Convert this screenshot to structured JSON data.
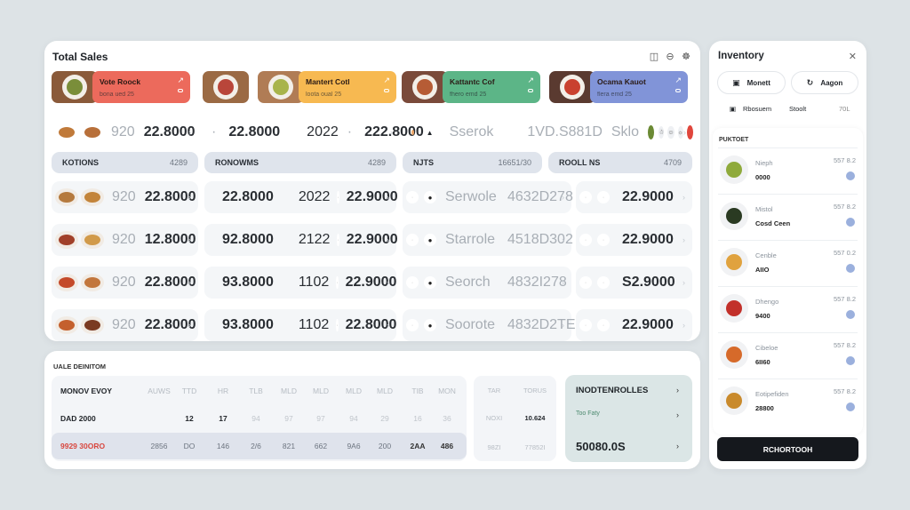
{
  "sales": {
    "title": "Total Sales",
    "header_icons": [
      "calendar-icon",
      "filter-icon",
      "globe-icon"
    ],
    "categories": [
      {
        "name": "Vote Roock",
        "sub": "bona ued 25",
        "color": "#ec6a5c",
        "food_color": "#7a8e3a"
      },
      {
        "name": "Mantert Cotl",
        "sub": "loota oual 25",
        "color": "#f7b951",
        "food_color": "#a8b44b"
      },
      {
        "name": "Kattantc Cof",
        "sub": "fhero emd 25",
        "color": "#5cb587",
        "food_color": "#b65c35"
      },
      {
        "name": "Ocama Kauot",
        "sub": "flera emd 25",
        "color": "#8194d8",
        "food_color": "#c9412f"
      }
    ],
    "top_row": {
      "c1_code": "920",
      "c1_value": "22.8000",
      "c2_value": "22.8000",
      "c2_code": "2022",
      "c2_total": "222.8000",
      "c3_label": "Sserok",
      "c3_code": "1VD.S881D",
      "c3_label2": "Sklo"
    },
    "sections": [
      {
        "name": "KOTIONS",
        "value": "4289"
      },
      {
        "name": "RONOWMS",
        "value": "4289"
      },
      {
        "name": "NJTS",
        "value": "16651/30"
      },
      {
        "name": "ROOLL NS",
        "value": "4709"
      }
    ],
    "rows": [
      {
        "code": "920",
        "value": "22.8000",
        "status": "#4e9c6c",
        "amount": "22.8000",
        "year": "2022",
        "total": "22.9000",
        "search": "Serwole",
        "sku": "4632D278",
        "price": "22.9000"
      },
      {
        "code": "920",
        "value": "12.8000",
        "status": "#4e9c6c",
        "amount": "92.8000",
        "year": "2122",
        "total": "22.9000",
        "search": "Starrole",
        "sku": "4518D302",
        "price": "22.9000"
      },
      {
        "code": "920",
        "value": "22.8000",
        "status": "#e59236",
        "amount": "93.8000",
        "year": "1102",
        "total": "22.9000",
        "search": "Seorch",
        "sku": "4832I278",
        "price": "S2.9000"
      },
      {
        "code": "920",
        "value": "22.8000",
        "status": "#4e9c6c",
        "amount": "93.8000",
        "year": "1102",
        "total": "22.8000",
        "search": "Soorote",
        "sku": "4832D2TE",
        "price": "22.9000"
      }
    ]
  },
  "bottom": {
    "title": "UALE DEINITOM",
    "headers": [
      "MONOV EVOY",
      "AUWS",
      "TTD",
      "HR",
      "TLB",
      "MLD",
      "MLD",
      "MLD",
      "MLD",
      "TIB",
      "MON"
    ],
    "row1": [
      "DAD 2000",
      "",
      "12",
      "17",
      "94",
      "97",
      "97",
      "94",
      "29",
      "16",
      "36"
    ],
    "row2": [
      "9929 30ORO",
      "2856",
      "DO",
      "146",
      "2/6",
      "821",
      "662",
      "9A6",
      "200",
      "2AA",
      "486"
    ],
    "side": {
      "headers": [
        "TAR",
        "TORUS"
      ],
      "row1": [
        "NOXI",
        "10.624"
      ],
      "row2": [
        "98ZI",
        "77852I"
      ]
    },
    "status_card": {
      "title": "INODTENROLLES",
      "subtitle": "Too Faty",
      "amount": "50080.0S"
    }
  },
  "inventory": {
    "title": "Inventory",
    "btn1": "Monett",
    "btn2": "Aagon",
    "tab1": "Rbosuem",
    "tab2": "Stoolt",
    "tab3": "70L",
    "list_header": "PUKTOET",
    "items": [
      {
        "name": "Nieph",
        "qty": "0000",
        "price": "557 8.2",
        "color": "#8faa3c"
      },
      {
        "name": "Mistol",
        "qty": "Cosd Ceen",
        "price": "557 8.2",
        "color": "#2a3a22"
      },
      {
        "name": "Cenble",
        "qty": "AIIO",
        "price": "557 0.2",
        "color": "#e0a23e"
      },
      {
        "name": "Dhengo",
        "qty": "9400",
        "price": "557 8.2",
        "color": "#c2302a"
      },
      {
        "name": "Cibeloe",
        "qty": "6II60",
        "price": "557 8.2",
        "color": "#d66a2a"
      },
      {
        "name": "Eotipefiden",
        "qty": "28800",
        "price": "557 8.2",
        "color": "#c98a2c"
      }
    ],
    "cta": "RCHORTOOH"
  }
}
